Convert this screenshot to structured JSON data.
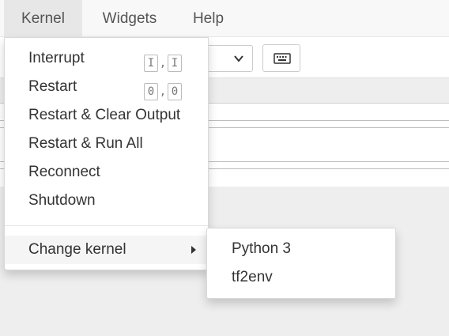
{
  "menubar": {
    "items": [
      {
        "label": "Kernel"
      },
      {
        "label": "Widgets"
      },
      {
        "label": "Help"
      }
    ]
  },
  "kernel_menu": {
    "items": [
      {
        "label": "Interrupt",
        "shortcut": [
          "I",
          "I"
        ]
      },
      {
        "label": "Restart",
        "shortcut": [
          "0",
          "0"
        ]
      },
      {
        "label": "Restart & Clear Output"
      },
      {
        "label": "Restart & Run All"
      },
      {
        "label": "Reconnect"
      },
      {
        "label": "Shutdown"
      },
      {
        "label": "Change kernel"
      }
    ],
    "shortcut_separator": ","
  },
  "change_kernel_submenu": {
    "items": [
      {
        "label": "Python 3"
      },
      {
        "label": "tf2env"
      }
    ]
  },
  "icons": {
    "toolbar_keyboard": "keyboard-icon",
    "select_chevron": "chevron-down-icon",
    "submenu_caret": "caret-right-icon"
  }
}
